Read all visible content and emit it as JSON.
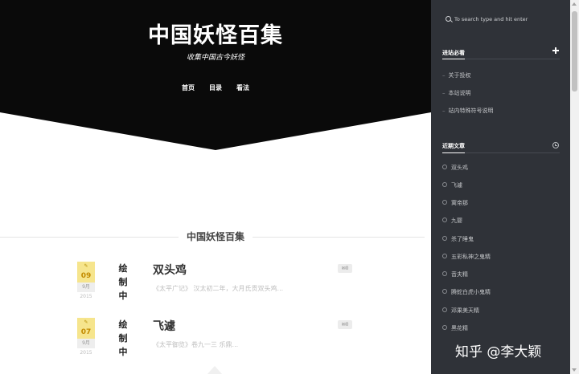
{
  "site": {
    "title": "中国妖怪百集",
    "subtitle": "收集中国古今妖怪"
  },
  "nav": [
    "首页",
    "目录",
    "看法"
  ],
  "section": {
    "heading": "中国妖怪百集"
  },
  "posts": [
    {
      "day": "09",
      "month": "9月",
      "year": "2015",
      "thumb": [
        "绘",
        "制",
        "中"
      ],
      "title": "双头鸡",
      "excerpt": "《太平广记》 汉太初二年，大月氏贡双头鸡...",
      "comments": "0"
    },
    {
      "day": "07",
      "month": "9月",
      "year": "2015",
      "thumb": [
        "绘",
        "制",
        "中"
      ],
      "title": "飞遽",
      "excerpt": "《太平御览》卷九一三 乐鼎...",
      "comments": "0"
    }
  ],
  "sidebar": {
    "search_placeholder": "To search type and hit enter",
    "must_read": {
      "title": "进站必看",
      "items": [
        "关于投权",
        "本站说明",
        "站内特殊符号说明"
      ]
    },
    "recent": {
      "title": "近期文章",
      "items": [
        "双头鸡",
        "飞遽",
        "寓帝那",
        "九婴",
        "杀了睡鬼",
        "五彩私神之鬼精",
        "音夫精",
        "腾蛇白虎小鬼精",
        "邓果美天精",
        "黑花精"
      ]
    }
  },
  "watermark": "知乎 @李大颖",
  "colors": {
    "hero": "#0a0a0a",
    "sidebar": "#2f3238",
    "date_badge": "#f6e58d"
  },
  "icons": [
    "pencil-icon",
    "comment-icon",
    "search-icon",
    "plus-icon",
    "clock-icon"
  ]
}
